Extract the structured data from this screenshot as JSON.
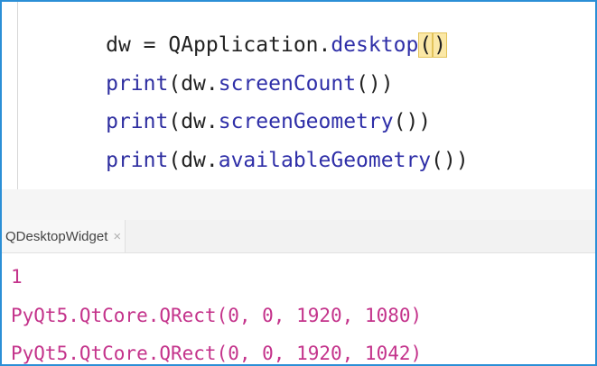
{
  "editor": {
    "lines": [
      {
        "var": "dw",
        "eq": " = ",
        "obj": "QApplication.",
        "method": "desktop",
        "open": "(",
        "close": ")"
      },
      {
        "fn": "print",
        "arg": "(dw.",
        "method": "screenCount",
        "call": "())"
      },
      {
        "fn": "print",
        "arg": "(dw.",
        "method": "screenGeometry",
        "call": "())"
      },
      {
        "fn": "print",
        "arg": "(dw.",
        "method": "availableGeometry",
        "call": "())"
      }
    ]
  },
  "console": {
    "tab_label": "QDesktopWidget",
    "tab_close": "×",
    "output": [
      "1",
      "PyQt5.QtCore.QRect(0, 0, 1920, 1080)",
      "PyQt5.QtCore.QRect(0, 0, 1920, 1042)"
    ]
  },
  "colors": {
    "border": "#2b8fd6",
    "output_text": "#c4338b",
    "keyword": "#2e2ea0",
    "bracket_highlight": "#fbe8a6"
  }
}
